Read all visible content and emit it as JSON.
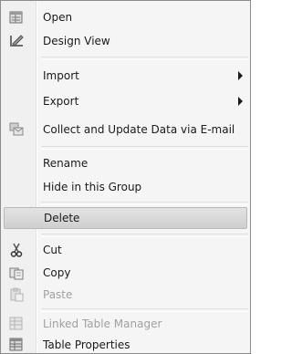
{
  "menu": {
    "items": [
      {
        "label": "Open",
        "icon": "open-icon"
      },
      {
        "label": "Design View",
        "icon": "design-view-icon"
      },
      {
        "label": "Import",
        "submenu": true
      },
      {
        "label": "Export",
        "submenu": true
      },
      {
        "label": "Collect and Update Data via E-mail",
        "icon": "collect-data-icon"
      },
      {
        "label": "Rename"
      },
      {
        "label": "Hide in this Group"
      },
      {
        "label": "Delete",
        "highlighted": true
      },
      {
        "label": "Cut",
        "icon": "scissors-icon"
      },
      {
        "label": "Copy",
        "icon": "copy-icon"
      },
      {
        "label": "Paste",
        "icon": "paste-icon",
        "disabled": true
      },
      {
        "label": "Linked Table Manager",
        "icon": "linked-table-manager-icon",
        "disabled": true
      },
      {
        "label": "Table Properties",
        "icon": "table-properties-icon"
      }
    ]
  }
}
